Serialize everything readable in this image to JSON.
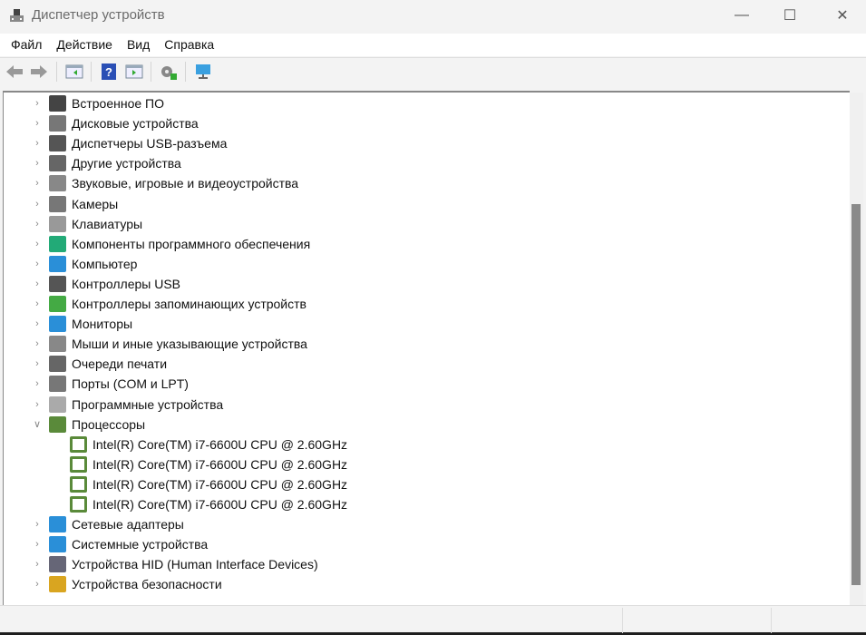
{
  "window": {
    "title": "Диспетчер устройств",
    "controls": {
      "minimize": "—",
      "maximize": "☐",
      "close": "✕"
    }
  },
  "menu": [
    "Файл",
    "Действие",
    "Вид",
    "Справка"
  ],
  "toolbar": [
    "back-icon",
    "forward-icon",
    "show-hide-console-tree-icon",
    "help-icon",
    "action-pane-icon",
    "update-driver-icon",
    "scan-hardware-icon"
  ],
  "tree": [
    {
      "label": "Встроенное ПО",
      "icon": "firmware-icon",
      "color": "#444"
    },
    {
      "label": "Дисковые устройства",
      "icon": "disk-icon",
      "color": "#777"
    },
    {
      "label": "Диспетчеры USB-разъема",
      "icon": "usb-connector-icon",
      "color": "#555"
    },
    {
      "label": "Другие устройства",
      "icon": "other-devices-icon",
      "color": "#666"
    },
    {
      "label": "Звуковые, игровые и видеоустройства",
      "icon": "speaker-icon",
      "color": "#888"
    },
    {
      "label": "Камеры",
      "icon": "camera-icon",
      "color": "#777"
    },
    {
      "label": "Клавиатуры",
      "icon": "keyboard-icon",
      "color": "#999"
    },
    {
      "label": "Компоненты программного обеспечения",
      "icon": "software-component-icon",
      "color": "#2a7"
    },
    {
      "label": "Компьютер",
      "icon": "computer-icon",
      "color": "#2a8fd8"
    },
    {
      "label": "Контроллеры USB",
      "icon": "usb-icon",
      "color": "#555"
    },
    {
      "label": "Контроллеры запоминающих устройств",
      "icon": "storage-controller-icon",
      "color": "#4a4"
    },
    {
      "label": "Мониторы",
      "icon": "monitor-icon",
      "color": "#2a8fd8"
    },
    {
      "label": "Мыши и иные указывающие устройства",
      "icon": "mouse-icon",
      "color": "#888"
    },
    {
      "label": "Очереди печати",
      "icon": "printer-icon",
      "color": "#666"
    },
    {
      "label": "Порты (COM и LPT)",
      "icon": "port-icon",
      "color": "#777"
    },
    {
      "label": "Программные устройства",
      "icon": "software-device-icon",
      "color": "#aaa"
    },
    {
      "label": "Процессоры",
      "icon": "processor-icon",
      "color": "#5a8a3a",
      "expanded": true,
      "children": [
        "Intel(R) Core(TM) i7-6600U CPU @ 2.60GHz",
        "Intel(R) Core(TM) i7-6600U CPU @ 2.60GHz",
        "Intel(R) Core(TM) i7-6600U CPU @ 2.60GHz",
        "Intel(R) Core(TM) i7-6600U CPU @ 2.60GHz"
      ]
    },
    {
      "label": "Сетевые адаптеры",
      "icon": "network-adapter-icon",
      "color": "#2a8fd8"
    },
    {
      "label": "Системные устройства",
      "icon": "system-devices-icon",
      "color": "#2a8fd8"
    },
    {
      "label": "Устройства HID (Human Interface Devices)",
      "icon": "hid-icon",
      "color": "#667"
    },
    {
      "label": "Устройства безопасности",
      "icon": "security-device-icon",
      "color": "#d9a520"
    }
  ]
}
